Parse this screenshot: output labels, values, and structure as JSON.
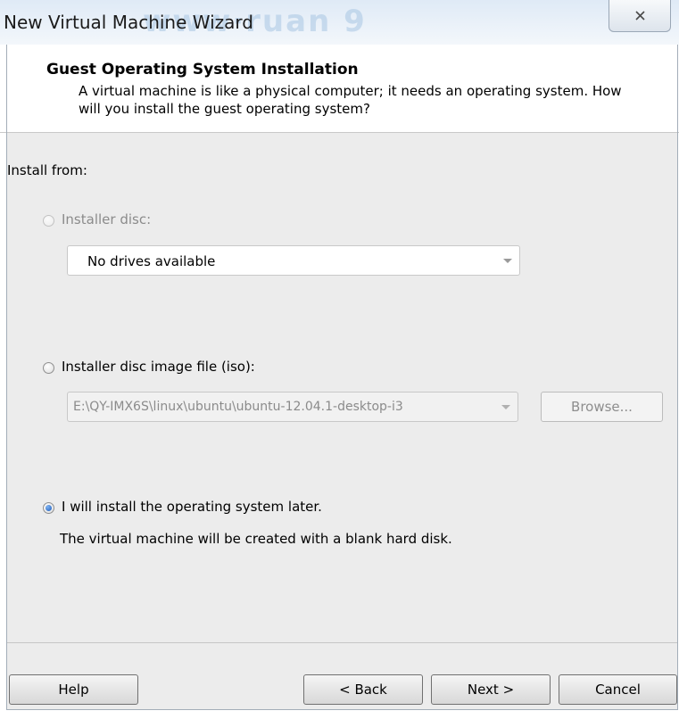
{
  "window": {
    "title": "New Virtual Machine Wizard",
    "close_glyph": "✕"
  },
  "header": {
    "title": "Guest Operating System Installation",
    "subtitle": "A virtual machine is like a physical computer; it needs an operating system. How will you install the guest operating system?"
  },
  "form": {
    "install_from_label": "Install from:",
    "options": [
      {
        "label": "Installer disc:",
        "selected": false,
        "enabled": false
      },
      {
        "label": "Installer disc image file (iso):",
        "selected": false,
        "enabled": true
      },
      {
        "label": "I will install the operating system later.",
        "selected": true,
        "enabled": true
      }
    ],
    "disc_drive": {
      "value": "No drives available",
      "enabled": false
    },
    "iso_path": {
      "value": "E:\\QY-IMX6S\\linux\\ubuntu\\ubuntu-12.04.1-desktop-i3",
      "enabled": false
    },
    "browse_label": "Browse...",
    "later_note": "The virtual machine will be created with a blank hard disk."
  },
  "footer": {
    "help_label": "Help",
    "back_label": "< Back",
    "next_label": "Next >",
    "cancel_label": "Cancel"
  },
  "colors": {
    "titlebar": "#dfeaf6",
    "content_bg": "#ececec",
    "radio_selected": "#1f5fbf",
    "disabled_text": "#8b8b8b"
  }
}
